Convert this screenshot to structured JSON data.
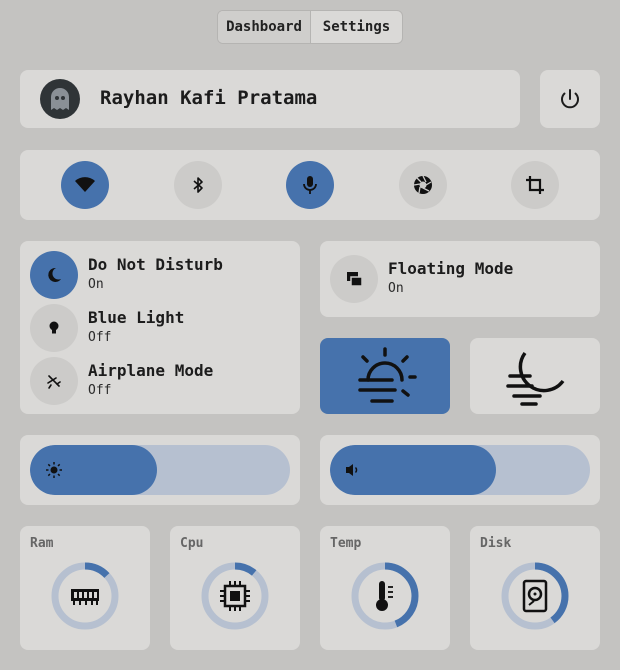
{
  "tabs": {
    "dashboard": "Dashboard",
    "settings": "Settings"
  },
  "profile": {
    "name": "Rayhan Kafi Pratama"
  },
  "toggles": {
    "dnd": {
      "label": "Do Not Disturb",
      "state": "On"
    },
    "blue_light": {
      "label": "Blue Light",
      "state": "Off"
    },
    "airplane": {
      "label": "Airplane Mode",
      "state": "Off"
    },
    "floating": {
      "label": "Floating Mode",
      "state": "On"
    }
  },
  "sliders": {
    "brightness": 0.49,
    "volume": 0.64
  },
  "monitors": [
    {
      "label": "Ram",
      "value": 0.13
    },
    {
      "label": "Cpu",
      "value": 0.11
    },
    {
      "label": "Temp",
      "value": 0.44
    },
    {
      "label": "Disk",
      "value": 0.4
    }
  ],
  "colors": {
    "accent": "#4672ac",
    "track": "#b6c0d0",
    "card": "#dad9d7",
    "background": "#c4c3c1"
  }
}
